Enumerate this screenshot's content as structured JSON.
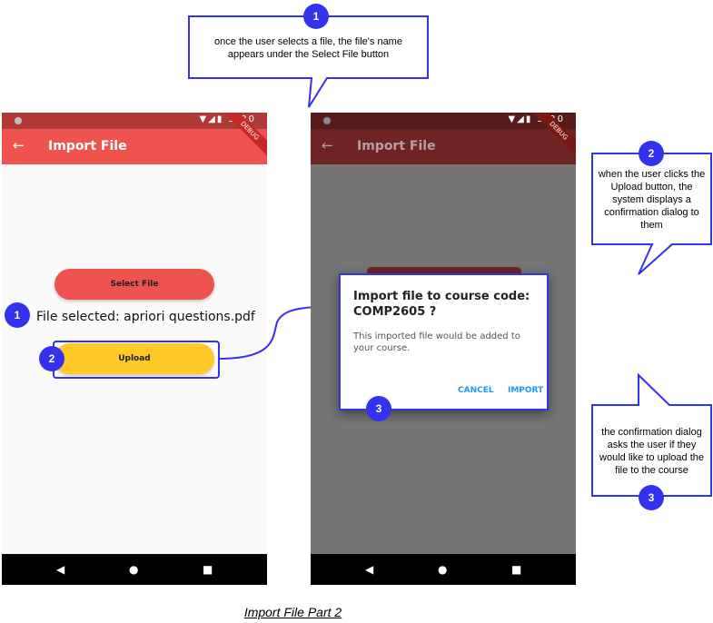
{
  "callouts": [
    {
      "number": "1",
      "text": "once the user selects a file, the file's name appears under the Select File button"
    },
    {
      "number": "2",
      "text": "when the user clicks the Upload button, the system displays a confirmation dialog to them"
    },
    {
      "number": "3",
      "text": "the confirmation dialog asks the user if they would like to upload the file to the course"
    }
  ],
  "badges": {
    "one": "1",
    "two": "2",
    "three": "3"
  },
  "phone": {
    "time": "5:20",
    "status_icons": "▼◢▮",
    "back_arrow": "←",
    "title": "Import File",
    "debug_label": "DEBUG",
    "nav_back": "◀",
    "nav_home": "●",
    "nav_recent": "■"
  },
  "screen1": {
    "select_label": "Select File",
    "file_selected": "File selected: apriori questions.pdf",
    "upload_label": "Upload"
  },
  "dialog": {
    "title": "Import file to course code: COMP2605 ?",
    "body": "This imported file would be added to your course.",
    "cancel": "CANCEL",
    "import": "IMPORT"
  },
  "caption": "Import File Part 2",
  "colors": {
    "appbar": "#ef5350",
    "appbar_dim": "#6d2423",
    "status": "#b03a38",
    "status_dim": "#561b1a",
    "overlay": "#757575",
    "select_button": "#ef5350",
    "upload_button": "#ffca28",
    "accent_blue": "#3333ee",
    "dialog_action": "#2196f3"
  }
}
